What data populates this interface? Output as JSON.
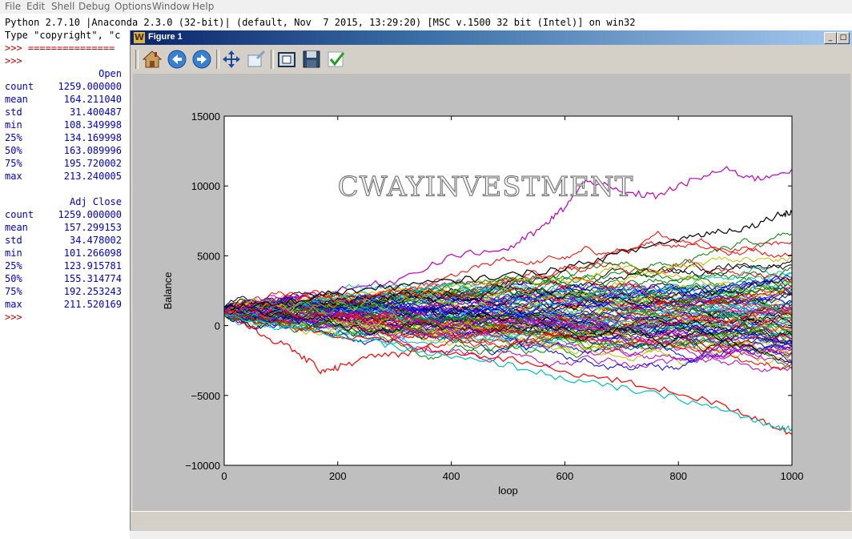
{
  "idle": {
    "menu": [
      "File",
      "Edit",
      "Shell",
      "Debug",
      "Options",
      "Window",
      "Help"
    ],
    "banner_line": "Python 2.7.10 |Anaconda 2.3.0 (32-bit)| (default, Nov  7 2015, 13:29:20) [MSC v.1500 32 bit (Intel)] on win32",
    "type_line_prefix": "Type \"copyright\", \"c",
    "prompt_sep": ">>> ===============",
    "prompt": ">>>",
    "open_header": "Open",
    "open_stats": [
      {
        "k": "count",
        "v": "1259.000000"
      },
      {
        "k": "mean",
        "v": "164.211040"
      },
      {
        "k": "std",
        "v": "31.400487"
      },
      {
        "k": "min",
        "v": "108.349998"
      },
      {
        "k": "25%",
        "v": "134.169998"
      },
      {
        "k": "50%",
        "v": "163.089996"
      },
      {
        "k": "75%",
        "v": "195.720002"
      },
      {
        "k": "max",
        "v": "213.240005"
      }
    ],
    "adj_header": "Adj Close",
    "adj_stats": [
      {
        "k": "count",
        "v": "1259.000000"
      },
      {
        "k": "mean",
        "v": "157.299153"
      },
      {
        "k": "std",
        "v": "34.478002"
      },
      {
        "k": "min",
        "v": "101.266098"
      },
      {
        "k": "25%",
        "v": "123.915781"
      },
      {
        "k": "50%",
        "v": "155.314774"
      },
      {
        "k": "75%",
        "v": "192.253243"
      },
      {
        "k": "max",
        "v": "211.520169"
      }
    ],
    "final_prompt": ">>>"
  },
  "figure_window": {
    "title": "Figure 1",
    "title_icon_glyph": "W",
    "toolbar": [
      {
        "name": "home-button",
        "icon": "home-icon"
      },
      {
        "name": "back-button",
        "icon": "arrow-left-icon"
      },
      {
        "name": "forward-button",
        "icon": "arrow-right-icon"
      },
      {
        "name": "pan-button",
        "icon": "move-arrows-icon"
      },
      {
        "name": "zoom-button",
        "icon": "zoom-rect-icon"
      },
      {
        "name": "subplots-button",
        "icon": "subplots-icon"
      },
      {
        "name": "save-button",
        "icon": "floppy-disk-icon"
      },
      {
        "name": "edit-button",
        "icon": "checkmark-icon"
      }
    ]
  },
  "chart_data": {
    "type": "line",
    "title": "",
    "xlabel": "loop",
    "ylabel": "Balance",
    "xlim": [
      0,
      1000
    ],
    "ylim": [
      -10000,
      15000
    ],
    "xticks": [
      0,
      200,
      400,
      600,
      800,
      1000
    ],
    "yticks": [
      -10000,
      -5000,
      0,
      5000,
      10000,
      15000
    ],
    "grid": false,
    "watermark": "CWAYINVESTMENT",
    "n_series": 100,
    "start_value": 1000,
    "series_colors": [
      "#0000ff",
      "#008000",
      "#ff0000",
      "#00bfbf",
      "#bf00bf",
      "#bfbf00",
      "#000000"
    ],
    "highlight_series": [
      {
        "color": "#bf00bf",
        "x": [
          0,
          100,
          200,
          300,
          400,
          500,
          560,
          600,
          640,
          700,
          760,
          820,
          880,
          940,
          1000
        ],
        "y": [
          1000,
          2000,
          2500,
          3200,
          5000,
          5500,
          7000,
          8500,
          10500,
          9500,
          9300,
          10300,
          11200,
          10500,
          11200
        ]
      },
      {
        "color": "#000000",
        "x": [
          0,
          100,
          200,
          300,
          400,
          500,
          600,
          700,
          800,
          860,
          920,
          980,
          1000
        ],
        "y": [
          1200,
          1600,
          2400,
          2800,
          3200,
          3600,
          4100,
          5200,
          6200,
          6700,
          7000,
          8000,
          8100
        ]
      },
      {
        "color": "#ff0000",
        "x": [
          0,
          60,
          120,
          170,
          200,
          260,
          330,
          400,
          450,
          500
        ],
        "y": [
          1000,
          -500,
          -1700,
          -3200,
          -3000,
          -2200,
          -2000,
          -1000,
          -500,
          0
        ]
      },
      {
        "color": "#ff0000",
        "x": [
          0,
          100,
          200,
          300,
          400,
          500,
          600,
          700,
          800,
          900,
          960,
          1000
        ],
        "y": [
          1000,
          300,
          -800,
          -1200,
          -2000,
          -2400,
          -3300,
          -4000,
          -4800,
          -6000,
          -7000,
          -7800
        ]
      },
      {
        "color": "#00bfbf",
        "x": [
          0,
          100,
          200,
          300,
          400,
          500,
          600,
          700,
          800,
          900,
          960,
          1000
        ],
        "y": [
          900,
          0,
          -700,
          -1500,
          -2300,
          -2800,
          -3800,
          -4500,
          -5200,
          -6300,
          -7200,
          -7400
        ]
      }
    ]
  }
}
